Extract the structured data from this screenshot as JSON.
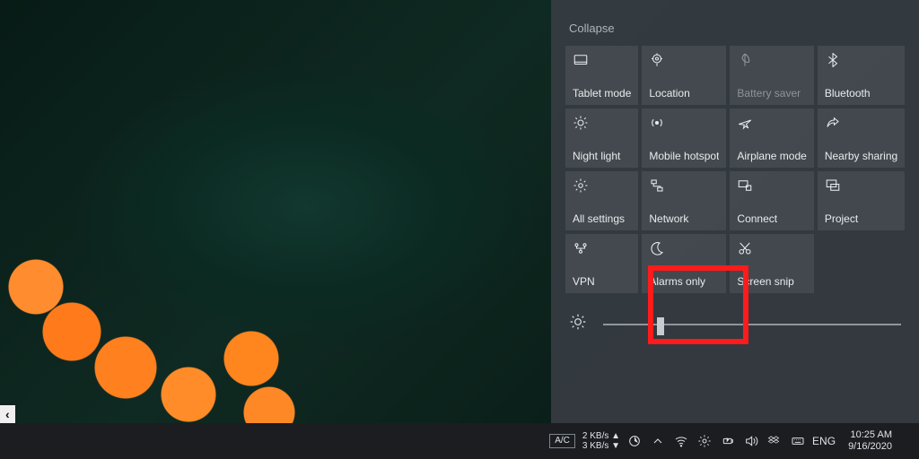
{
  "action_center": {
    "collapse_label": "Collapse",
    "tiles": [
      {
        "id": "tablet-mode",
        "label": "Tablet mode",
        "icon": "tablet-icon",
        "disabled": false
      },
      {
        "id": "location",
        "label": "Location",
        "icon": "location-icon",
        "disabled": false
      },
      {
        "id": "battery-saver",
        "label": "Battery saver",
        "icon": "leaf-icon",
        "disabled": true
      },
      {
        "id": "bluetooth",
        "label": "Bluetooth",
        "icon": "bluetooth-icon",
        "disabled": false
      },
      {
        "id": "night-light",
        "label": "Night light",
        "icon": "sun-icon",
        "disabled": false
      },
      {
        "id": "mobile-hotspot",
        "label": "Mobile hotspot",
        "icon": "hotspot-icon",
        "disabled": false
      },
      {
        "id": "airplane-mode",
        "label": "Airplane mode",
        "icon": "airplane-icon",
        "disabled": false
      },
      {
        "id": "nearby-sharing",
        "label": "Nearby sharing",
        "icon": "share-icon",
        "disabled": false
      },
      {
        "id": "all-settings",
        "label": "All settings",
        "icon": "gear-icon",
        "disabled": false
      },
      {
        "id": "network",
        "label": "Network",
        "icon": "network-icon",
        "disabled": false
      },
      {
        "id": "connect",
        "label": "Connect",
        "icon": "connect-icon",
        "disabled": false
      },
      {
        "id": "project",
        "label": "Project",
        "icon": "project-icon",
        "disabled": false
      },
      {
        "id": "vpn",
        "label": "VPN",
        "icon": "vpn-icon",
        "disabled": false
      },
      {
        "id": "alarms-only",
        "label": "Alarms only",
        "icon": "moon-icon",
        "disabled": false,
        "highlighted": true
      },
      {
        "id": "screen-snip",
        "label": "Screen snip",
        "icon": "snip-icon",
        "disabled": false
      }
    ],
    "brightness_percent": 18
  },
  "taskbar": {
    "ac_badge": "A/C",
    "net_up": "2 KB/s ▲",
    "net_down": "3 KB/s ▼",
    "lang": "ENG",
    "time": "10:25 AM",
    "date": "9/16/2020"
  },
  "start_chip": "‹"
}
